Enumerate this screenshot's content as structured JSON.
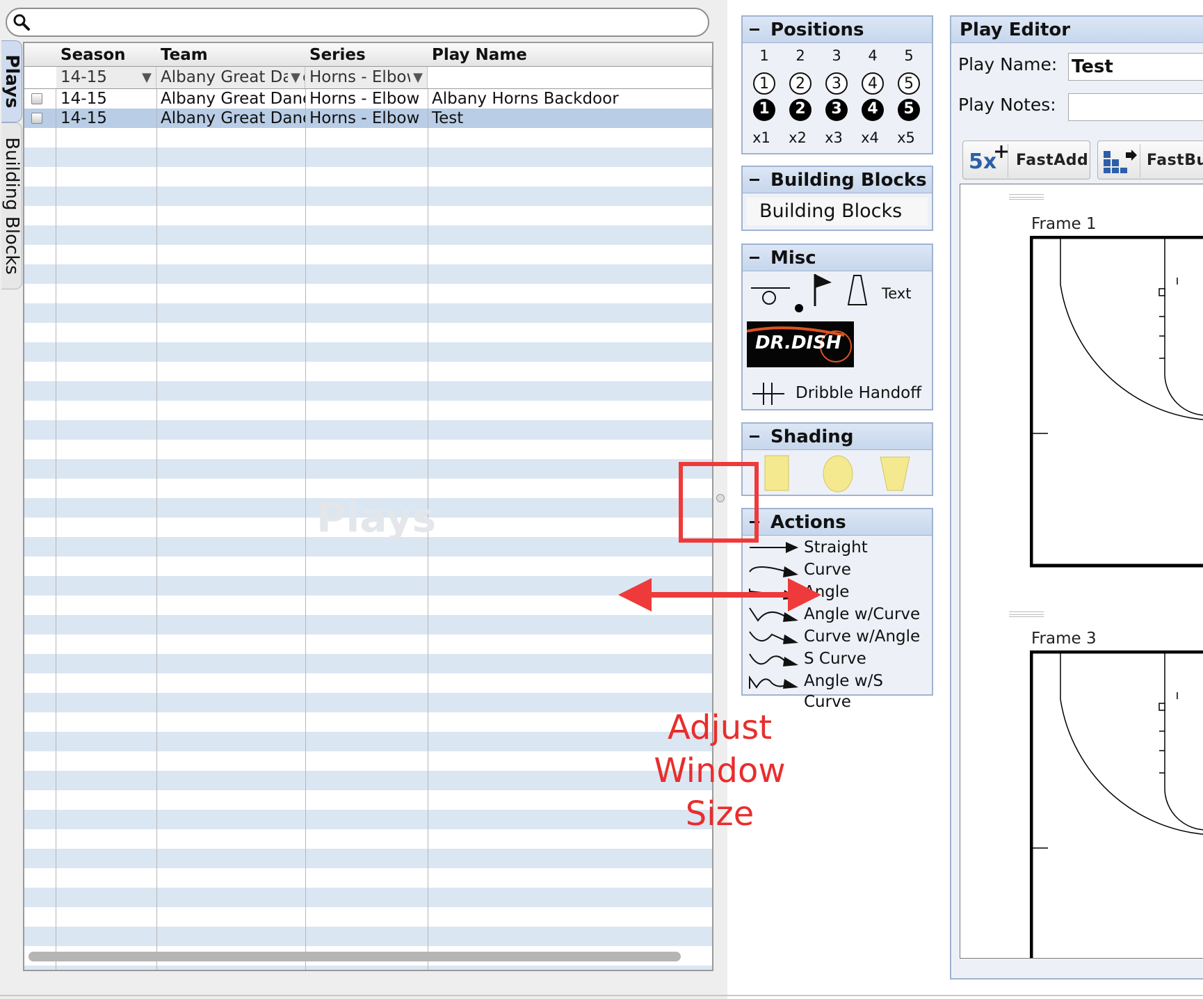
{
  "tabs": {
    "plays": "Plays",
    "building_blocks": "Building Blocks"
  },
  "search": {
    "icon": "magnifier-icon",
    "placeholder": ""
  },
  "table": {
    "columns": [
      "Season",
      "Team",
      "Series",
      "Play Name"
    ],
    "filters": {
      "season": "14-15",
      "team": "Albany Great Danes",
      "series": "Horns - Elbow",
      "play_name": ""
    },
    "rows": [
      {
        "season": "14-15",
        "team": "Albany Great Danes",
        "series": "Horns - Elbow",
        "play_name": "Albany Horns Backdoor",
        "selected": false
      },
      {
        "season": "14-15",
        "team": "Albany Great Danes",
        "series": "Horns - Elbow",
        "play_name": "Test",
        "selected": true
      }
    ],
    "watermark": "Plays"
  },
  "positions": {
    "title": "Positions",
    "numbers": [
      "1",
      "2",
      "3",
      "4",
      "5"
    ],
    "multipliers": [
      "x1",
      "x2",
      "x3",
      "x4",
      "x5"
    ]
  },
  "building_blocks": {
    "title": "Building Blocks",
    "item": "Building Blocks"
  },
  "misc": {
    "title": "Misc",
    "text_tool": "Text",
    "logo": "DR.DISH",
    "handoff": "Dribble Handoff"
  },
  "shading": {
    "title": "Shading"
  },
  "actions": {
    "title": "Actions",
    "items": [
      "Straight",
      "Curve",
      "Angle",
      "Angle w/Curve",
      "Curve w/Angle",
      "S Curve",
      "Angle w/S Curve"
    ]
  },
  "editor": {
    "title": "Play Editor",
    "play_name_label": "Play Name:",
    "play_name_value": "Test",
    "play_notes_label": "Play Notes:",
    "play_notes_value": "",
    "fastadd_badge": "5x",
    "fastadd_label": "FastAdd",
    "fastbu_label": "FastBu",
    "frames": [
      "Frame 1",
      "Frame 3"
    ]
  },
  "annotation": {
    "line1": "Adjust Window",
    "line2": "Size"
  },
  "colors": {
    "accent": "#9fb3d1",
    "annotation": "#e92d2d",
    "row_stripe": "#dbe6f3",
    "selected_row": "#b9cde6",
    "shading_fill": "#f4e98f"
  }
}
